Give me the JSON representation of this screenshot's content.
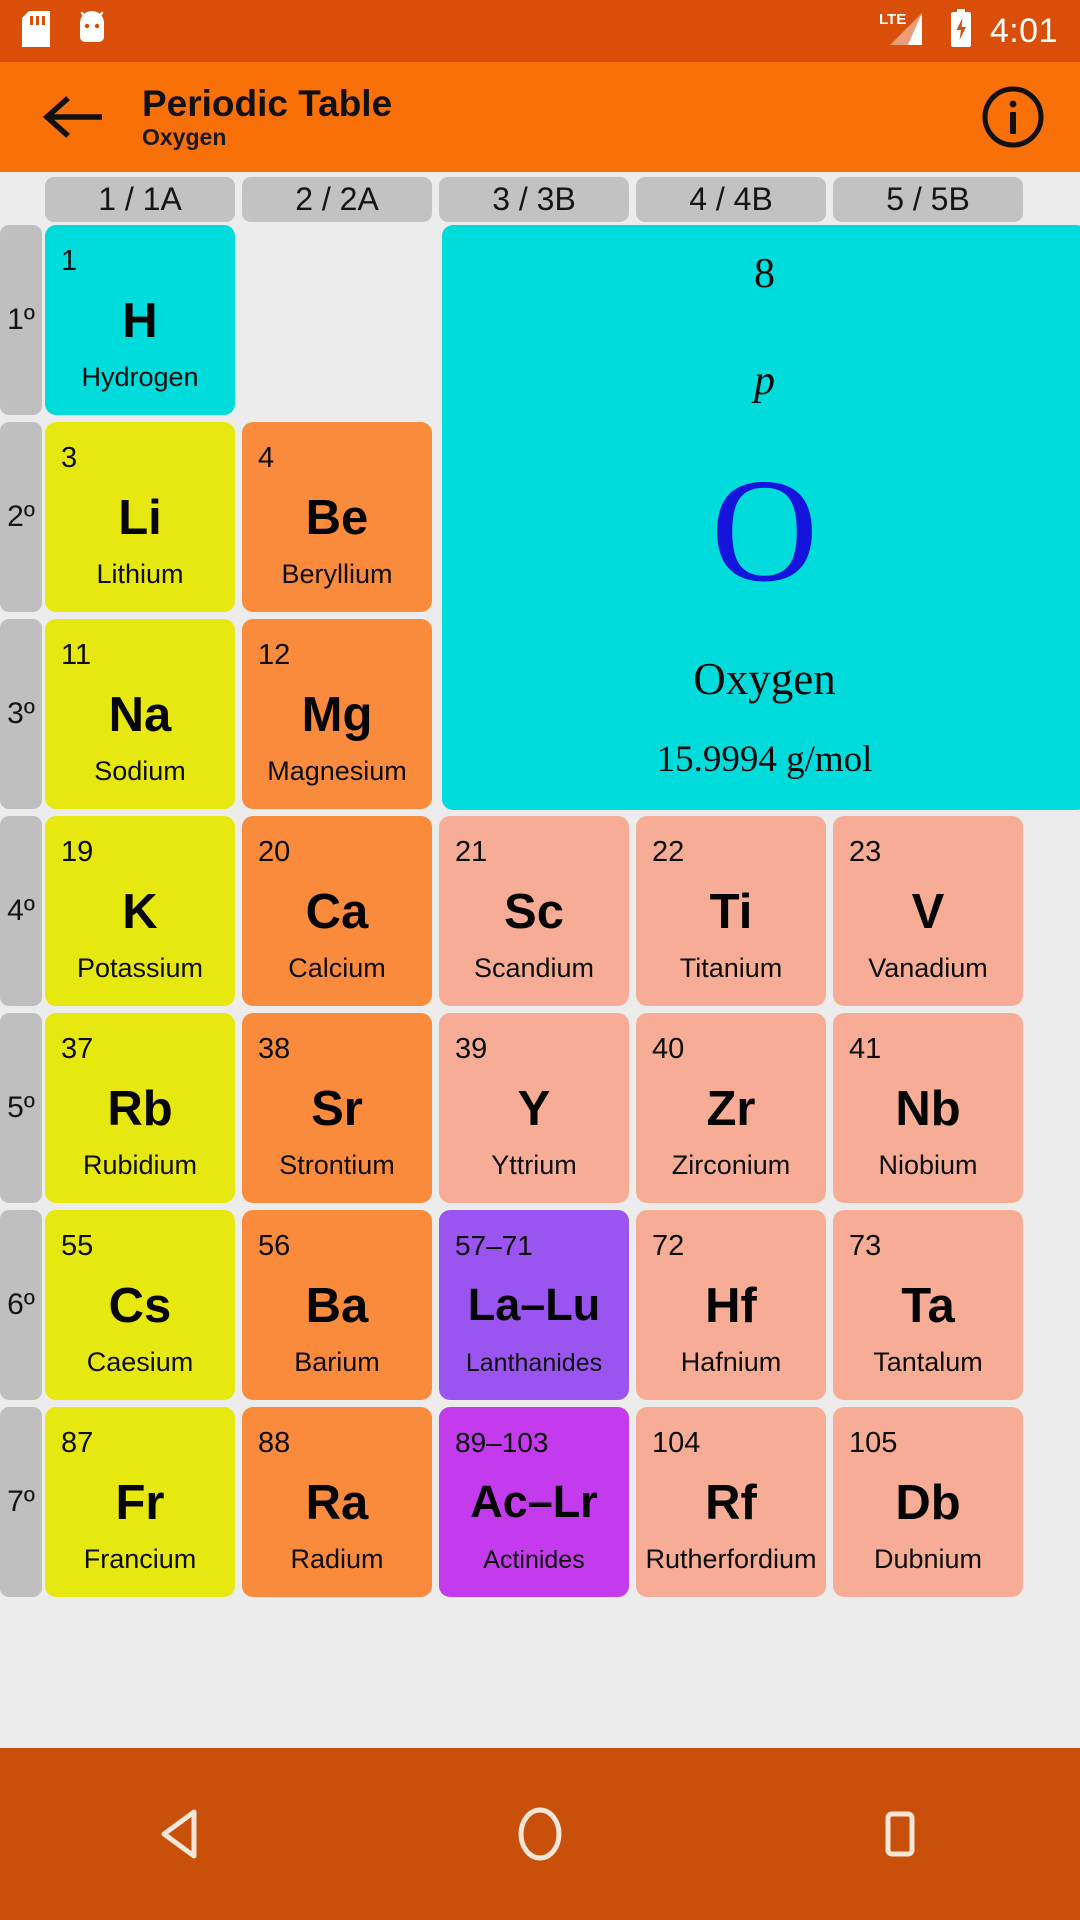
{
  "status_bar": {
    "time": "4:01",
    "network_label": "LTE",
    "icons": [
      "sd-card-icon",
      "android-debug-icon",
      "lte-signal-icon",
      "battery-charging-icon"
    ]
  },
  "app_bar": {
    "back_icon": "arrow-left-icon",
    "title": "Periodic Table",
    "subtitle": "Oxygen",
    "info_icon": "info-circle-icon"
  },
  "group_headers": [
    "1 / 1A",
    "2 / 2A",
    "3 / 3B",
    "4 / 4B",
    "5 / 5B"
  ],
  "period_labels": [
    "1º",
    "2º",
    "3º",
    "4º",
    "5º",
    "6º",
    "7º"
  ],
  "colors": {
    "accent": "#F97008",
    "status_bar": "#D94E09",
    "nav_bar": "#C8500A",
    "background": "#ececec",
    "header_chip": "#c2c2c2",
    "alkali": "#E8E811",
    "alkaline_earth": "#FA8A3C",
    "transition": "#F7AD95",
    "nonmetal": "#00DBDB",
    "lanthanide": "#9A55F0",
    "actinide": "#C33BEC",
    "symbol_highlight": "#1414DD"
  },
  "detail": {
    "atomic_number": "8",
    "block": "p",
    "symbol": "O",
    "name": "Oxygen",
    "molar_mass": "15.9994 g/mol"
  },
  "rows": [
    [
      {
        "num": "1",
        "sym": "H",
        "name": "Hydrogen",
        "color": "#00DBDB"
      },
      {
        "empty": true
      },
      {
        "empty": true
      },
      {
        "empty": true
      },
      {
        "empty": true
      }
    ],
    [
      {
        "num": "3",
        "sym": "Li",
        "name": "Lithium",
        "color": "#E8E811"
      },
      {
        "num": "4",
        "sym": "Be",
        "name": "Beryllium",
        "color": "#FA8A3C"
      },
      {
        "empty": true
      },
      {
        "empty": true
      },
      {
        "empty": true
      }
    ],
    [
      {
        "num": "11",
        "sym": "Na",
        "name": "Sodium",
        "color": "#E8E811"
      },
      {
        "num": "12",
        "sym": "Mg",
        "name": "Magnesium",
        "color": "#FA8A3C"
      },
      {
        "empty": true
      },
      {
        "empty": true
      },
      {
        "empty": true
      }
    ],
    [
      {
        "num": "19",
        "sym": "K",
        "name": "Potassium",
        "color": "#E8E811"
      },
      {
        "num": "20",
        "sym": "Ca",
        "name": "Calcium",
        "color": "#FA8A3C"
      },
      {
        "num": "21",
        "sym": "Sc",
        "name": "Scandium",
        "color": "#F7AD95"
      },
      {
        "num": "22",
        "sym": "Ti",
        "name": "Titanium",
        "color": "#F7AD95"
      },
      {
        "num": "23",
        "sym": "V",
        "name": "Vanadium",
        "color": "#F7AD95"
      }
    ],
    [
      {
        "num": "37",
        "sym": "Rb",
        "name": "Rubidium",
        "color": "#E8E811"
      },
      {
        "num": "38",
        "sym": "Sr",
        "name": "Strontium",
        "color": "#FA8A3C"
      },
      {
        "num": "39",
        "sym": "Y",
        "name": "Yttrium",
        "color": "#F7AD95"
      },
      {
        "num": "40",
        "sym": "Zr",
        "name": "Zirconium",
        "color": "#F7AD95"
      },
      {
        "num": "41",
        "sym": "Nb",
        "name": "Niobium",
        "color": "#F7AD95"
      }
    ],
    [
      {
        "num": "55",
        "sym": "Cs",
        "name": "Caesium",
        "color": "#E8E811"
      },
      {
        "num": "56",
        "sym": "Ba",
        "name": "Barium",
        "color": "#FA8A3C"
      },
      {
        "num": "57–71",
        "sym": "La–Lu",
        "name": "Lanthanides",
        "color": "#9A55F0",
        "combo": true
      },
      {
        "num": "72",
        "sym": "Hf",
        "name": "Hafnium",
        "color": "#F7AD95"
      },
      {
        "num": "73",
        "sym": "Ta",
        "name": "Tantalum",
        "color": "#F7AD95"
      }
    ],
    [
      {
        "num": "87",
        "sym": "Fr",
        "name": "Francium",
        "color": "#E8E811"
      },
      {
        "num": "88",
        "sym": "Ra",
        "name": "Radium",
        "color": "#FA8A3C"
      },
      {
        "num": "89–103",
        "sym": "Ac–Lr",
        "name": "Actinides",
        "color": "#C33BEC",
        "combo": true
      },
      {
        "num": "104",
        "sym": "Rf",
        "name": "Rutherfordium",
        "color": "#F7AD95"
      },
      {
        "num": "105",
        "sym": "Db",
        "name": "Dubnium",
        "color": "#F7AD95"
      }
    ]
  ],
  "nav_bar": {
    "back_icon": "triangle-back-icon",
    "home_icon": "circle-home-icon",
    "recents_icon": "square-recents-icon"
  }
}
